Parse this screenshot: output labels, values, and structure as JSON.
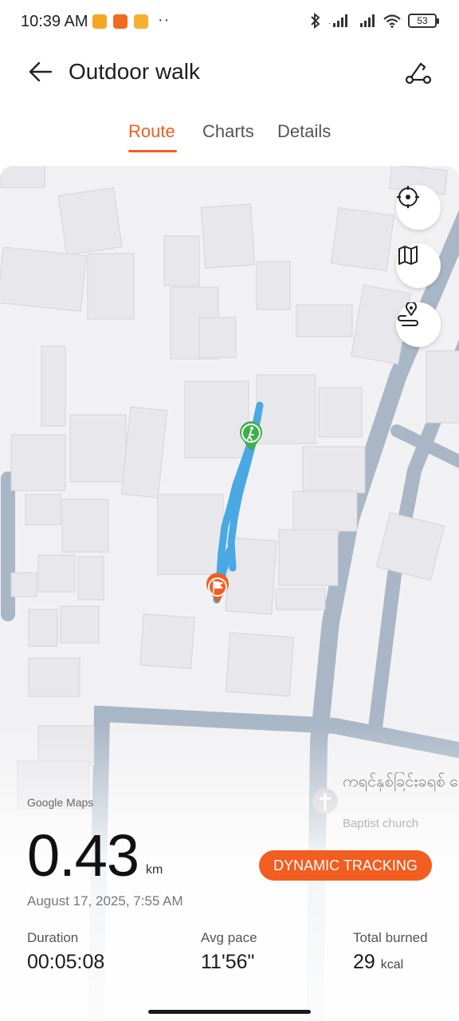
{
  "status_bar": {
    "time": "10:39 AM",
    "notification_dots": "··",
    "battery": "53",
    "icons": [
      "heart-app-icon",
      "mi-app-icon",
      "message-app-icon",
      "bluetooth-icon",
      "signal-icon",
      "signal-icon",
      "wifi-icon",
      "battery-icon"
    ]
  },
  "header": {
    "title": "Outdoor walk",
    "back_icon": "arrow-left-icon",
    "route_icon": "route-share-icon"
  },
  "tabs": [
    {
      "label": "Route",
      "active": true
    },
    {
      "label": "Charts",
      "active": false
    },
    {
      "label": "Details",
      "active": false
    }
  ],
  "map": {
    "attribution": "Google Maps",
    "poi": {
      "name": "ကရင်နှစ်ခြင်းခရစ် တော်",
      "subtitle": "Baptist church",
      "icon": "church-cross-icon"
    },
    "controls": [
      "locate-icon",
      "map-layers-icon",
      "route-pin-icon"
    ],
    "route_color": "#4aa8e2",
    "start_marker": "walker-start-icon",
    "end_marker": "flag-finish-icon"
  },
  "summary": {
    "distance": "0.43",
    "distance_unit": "km",
    "tracking_button": "DYNAMIC TRACKING",
    "date": "August 17, 2025, 7:55 AM",
    "stats": [
      {
        "label": "Duration",
        "value": "00:05:08",
        "unit": ""
      },
      {
        "label": "Avg pace",
        "value": "11'56\"",
        "unit": ""
      },
      {
        "label": "Total burned",
        "value": "29",
        "unit": "kcal"
      }
    ]
  },
  "colors": {
    "accent": "#f25d20",
    "start_marker": "#3fae49",
    "road": "#a9b6c6"
  }
}
